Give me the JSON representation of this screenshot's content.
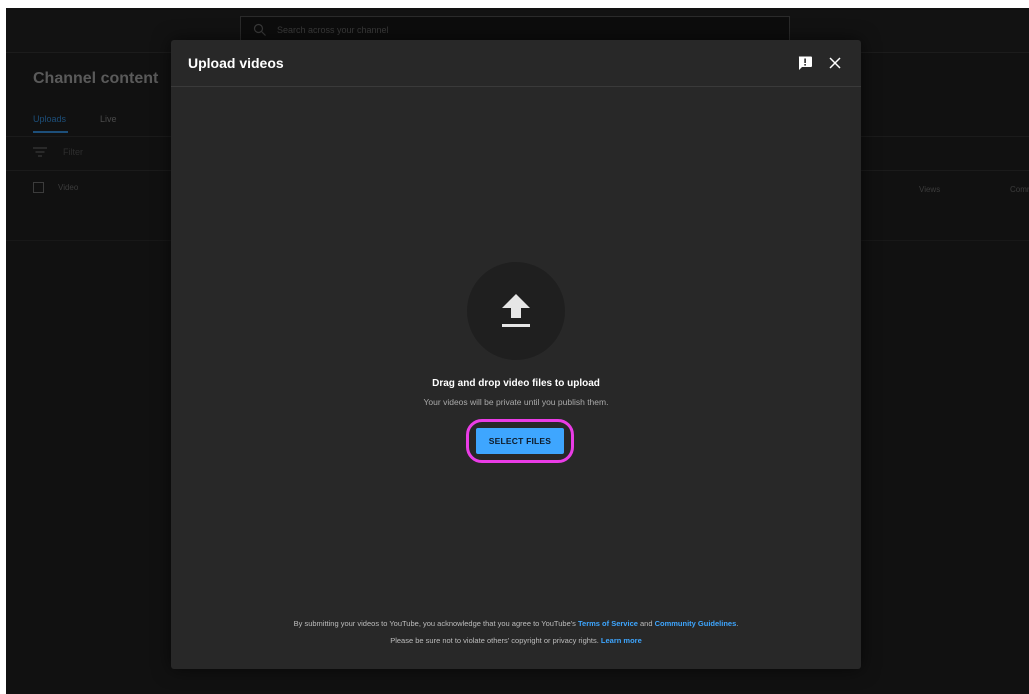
{
  "background": {
    "search": {
      "placeholder": "Search across your channel",
      "icon": "search-icon"
    },
    "page_title": "Channel content",
    "tabs": [
      {
        "label": "Uploads",
        "active": true
      },
      {
        "label": "Live",
        "active": false
      }
    ],
    "filter": {
      "icon": "filter-icon",
      "label": "Filter"
    },
    "table_header": {
      "video": "Video",
      "views": "Views",
      "comments": "Comm"
    }
  },
  "modal": {
    "title": "Upload videos",
    "feedback_icon": "feedback-icon",
    "close_icon": "close-icon",
    "upload_icon": "upload-arrow-icon",
    "drag_text": "Drag and drop video files to upload",
    "private_text": "Your videos will be private until you publish them.",
    "select_button": "SELECT FILES",
    "terms": {
      "line1_prefix": "By submitting your videos to YouTube, you acknowledge that you agree to YouTube's ",
      "terms_link": "Terms of Service",
      "and": " and ",
      "guidelines_link": "Community Guidelines",
      "line1_suffix": ".",
      "line2_prefix": "Please be sure not to violate others' copyright or privacy rights. ",
      "learn_more_link": "Learn more"
    }
  },
  "colors": {
    "accent": "#3ea6ff",
    "highlight": "#ea3ce6",
    "modal_bg": "#282828",
    "screen_bg": "#111111"
  }
}
